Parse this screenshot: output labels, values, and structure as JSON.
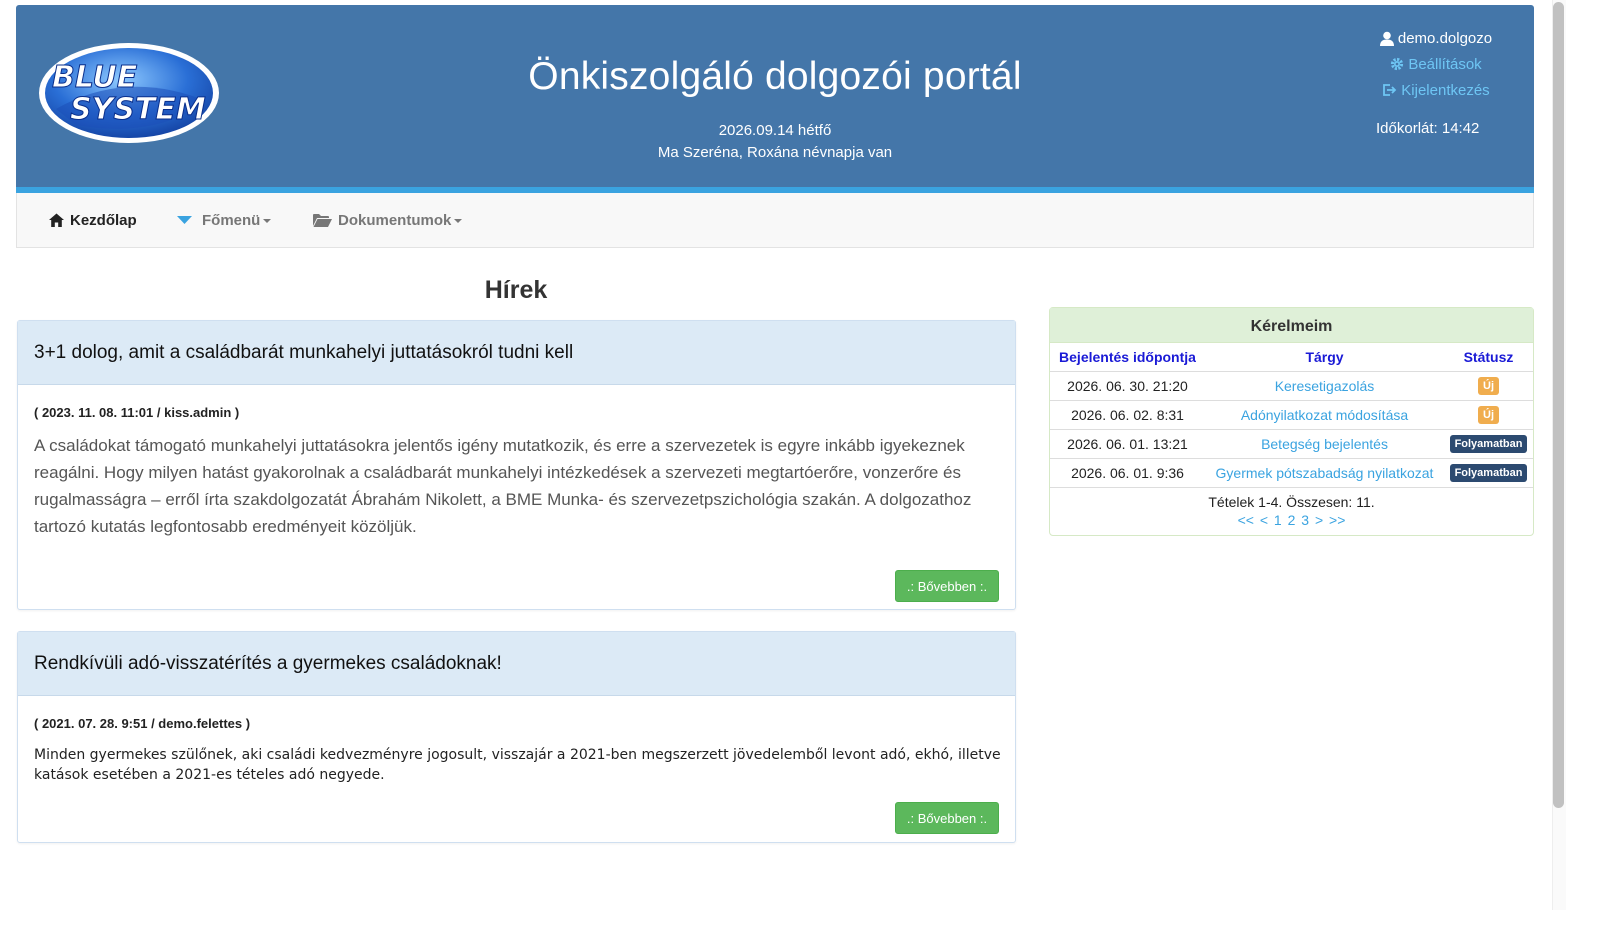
{
  "header": {
    "logo_text_line1": "BLUE",
    "logo_text_line2": "SYSTEM",
    "title": "Önkiszolgáló dolgozói portál",
    "date": "2026.09.14 hétfő",
    "nameday": "Ma Szeréna, Roxána névnapja van",
    "username": "demo.dolgozo",
    "settings_label": "Beállítások",
    "logout_label": "Kijelentkezés",
    "timeout": "Időkorlát: 14:42"
  },
  "nav": {
    "home": "Kezdőlap",
    "main_menu": "Főmenü",
    "documents": "Dokumentumok"
  },
  "news": {
    "heading": "Hírek",
    "more_label": ".: Bővebben :.",
    "items": [
      {
        "title": "3+1 dolog, amit a családbarát munkahelyi juttatásokról tudni kell",
        "meta": "( 2023. 11. 08. 11:01 / kiss.admin )",
        "body": "A családokat támogató munkahelyi juttatásokra jelentős igény mutatkozik, és erre a szervezetek is egyre inkább igyekeznek reagálni. Hogy milyen hatást gyakorolnak a családbarát munkahelyi intézkedések a szervezeti megtartóerőre, vonzerőre és rugalmasságra – erről írta szakdolgozatát Ábrahám Nikolett, a BME Munka- és szervezetpszichológia szakán. A dolgozathoz tartozó kutatás legfontosabb eredményeit közöljük."
      },
      {
        "title": "Rendkívüli adó-visszatérítés a gyermekes családoknak!",
        "meta": "( 2021. 07. 28. 9:51 / demo.felettes )",
        "body": "Minden gyermekes szülőnek, aki családi kedvezményre jogosult, visszajár a 2021-ben megszerzett jövedelemből levont adó, ekhó, illetve katások esetében a 2021-es tételes adó negyede."
      }
    ]
  },
  "requests": {
    "title": "Kérelmeim",
    "columns": [
      "Bejelentés időpontja",
      "Tárgy",
      "Státusz"
    ],
    "rows": [
      {
        "date": "2026. 06. 30. 21:20",
        "subject": "Keresetigazolás",
        "status": "Új"
      },
      {
        "date": "2026. 06. 02. 8:31",
        "subject": "Adónyilatkozat módosítása",
        "status": "Új"
      },
      {
        "date": "2026. 06. 01. 13:21",
        "subject": "Betegség bejelentés",
        "status": "Folyamatban"
      },
      {
        "date": "2026. 06. 01. 9:36",
        "subject": "Gyermek pótszabadság nyilatkozat",
        "status": "Folyamatban"
      }
    ],
    "summary": "Tételek 1-4. Összesen: 11.",
    "pager": {
      "first": "<<",
      "prev": "<",
      "pages": [
        "1",
        "2",
        "3"
      ],
      "next": ">",
      "last": ">>"
    }
  },
  "colors": {
    "header_bg": "#4476a9",
    "header_border": "#3aa3e0",
    "link": "#3aa3e0",
    "button_green": "#5cb85c",
    "badge_new": "#f0ad4e",
    "badge_progress": "#2c4a70"
  }
}
